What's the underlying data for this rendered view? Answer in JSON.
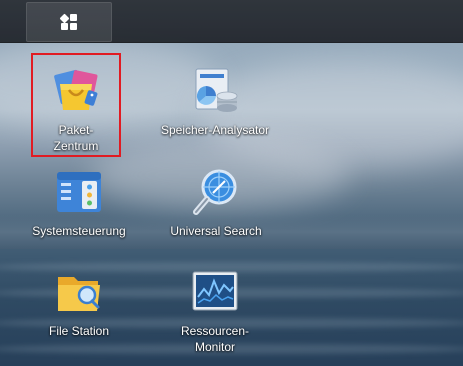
{
  "desktop": {
    "icons": [
      {
        "label_lines": [
          "Paket-",
          "Zentrum"
        ],
        "icon": "package-center-icon"
      },
      {
        "label_lines": [
          "Speicher-Analysator"
        ],
        "icon": "storage-analyzer-icon"
      },
      {
        "label_lines": [
          "Systemsteuerung"
        ],
        "icon": "control-panel-icon"
      },
      {
        "label_lines": [
          "Universal Search"
        ],
        "icon": "universal-search-icon"
      },
      {
        "label_lines": [
          "File Station"
        ],
        "icon": "file-station-icon"
      },
      {
        "label_lines": [
          "Ressourcen-",
          "Monitor"
        ],
        "icon": "resource-monitor-icon"
      }
    ],
    "highlight": {
      "target": "Paket-Zentrum",
      "color": "#e11b22"
    }
  },
  "taskbar": {
    "main_menu_icon": "grid-menu-icon"
  }
}
